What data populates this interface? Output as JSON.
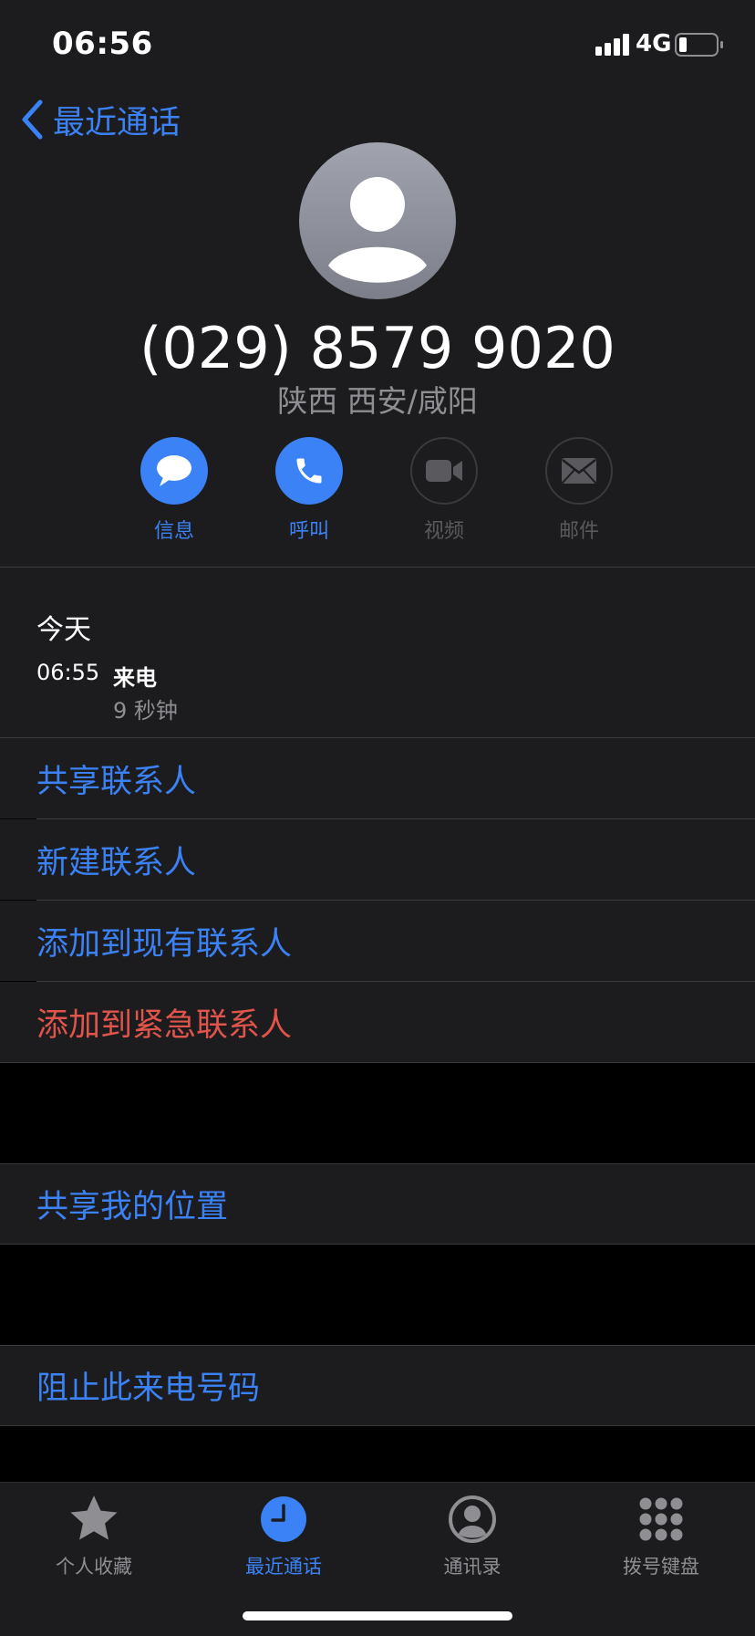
{
  "status_bar": {
    "time": "06:56",
    "network": "4G"
  },
  "header": {
    "back_label": "最近通话"
  },
  "contact": {
    "number": "(029) 8579 9020",
    "location": "陕西 西安/咸阳"
  },
  "actions": [
    {
      "label": "信息",
      "icon": "message-icon",
      "enabled": true
    },
    {
      "label": "呼叫",
      "icon": "phone-icon",
      "enabled": true
    },
    {
      "label": "视频",
      "icon": "video-icon",
      "enabled": false
    },
    {
      "label": "邮件",
      "icon": "mail-icon",
      "enabled": false
    }
  ],
  "history": {
    "date": "今天",
    "time": "06:55",
    "type": "来电",
    "duration": "9 秒钟"
  },
  "options": {
    "share_contact": "共享联系人",
    "new_contact": "新建联系人",
    "add_existing": "添加到现有联系人",
    "add_emergency": "添加到紧急联系人",
    "share_location": "共享我的位置",
    "block_caller": "阻止此来电号码"
  },
  "colors": {
    "accent": "#3b82f6",
    "danger": "#e0544b"
  },
  "tabs": [
    {
      "label": "个人收藏",
      "icon": "star-icon",
      "active": false
    },
    {
      "label": "最近通话",
      "icon": "clock-icon",
      "active": true
    },
    {
      "label": "通讯录",
      "icon": "person-circle-icon",
      "active": false
    },
    {
      "label": "拨号键盘",
      "icon": "keypad-icon",
      "active": false
    }
  ]
}
